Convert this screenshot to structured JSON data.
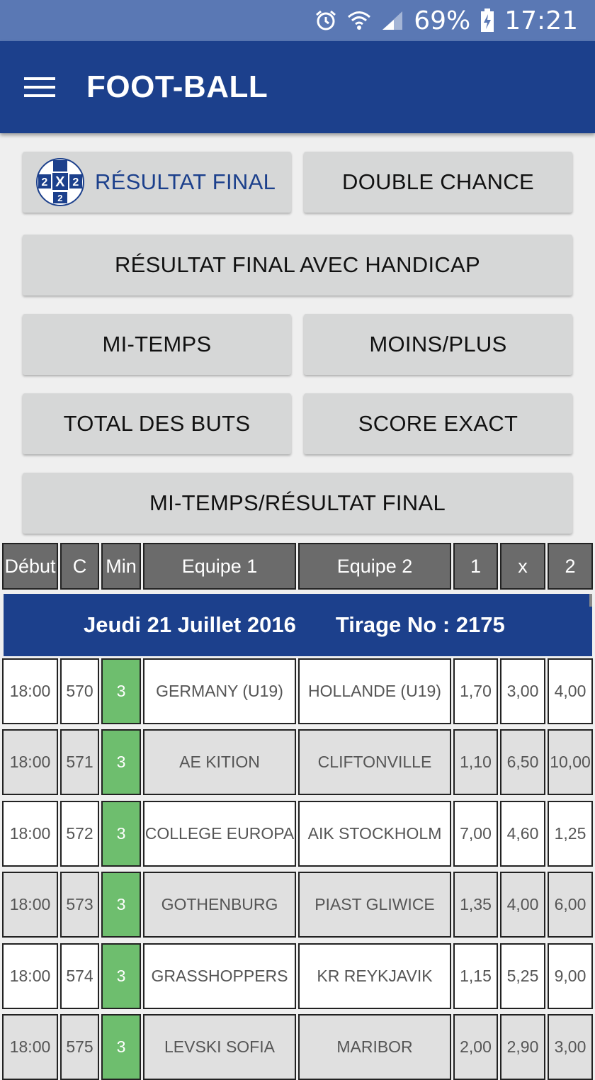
{
  "status_bar": {
    "battery": "69%",
    "time": "17:21",
    "icons": [
      "alarm-icon",
      "wifi-icon",
      "signal-icon",
      "battery-charging-icon"
    ]
  },
  "app_bar": {
    "title": "FOOT-BALL",
    "menu_icon": "hamburger-menu-icon"
  },
  "bet_types": {
    "resultat_final": "RÉSULTAT FINAL",
    "double_chance": "DOUBLE CHANCE",
    "handicap": "RÉSULTAT FINAL AVEC HANDICAP",
    "mi_temps": "MI-TEMPS",
    "moins_plus": "MOINS/PLUS",
    "total_buts": "TOTAL DES BUTS",
    "score_exact": "SCORE EXACT",
    "mi_temps_resultat": "MI-TEMPS/RÉSULTAT FINAL",
    "active_icon": "1x2-ball-icon",
    "active_color": "#1c408c"
  },
  "table": {
    "headers": [
      "Début",
      "C",
      "Min",
      "Equipe 1",
      "Equipe 2",
      "1",
      "x",
      "2"
    ],
    "date_label": "Jeudi 21 Juillet 2016",
    "draw_label": "Tirage No : 2175",
    "rows": [
      [
        "18:00",
        "570",
        "3",
        "GERMANY (U19)",
        "HOLLANDE (U19)",
        "1,70",
        "3,00",
        "4,00"
      ],
      [
        "18:00",
        "571",
        "3",
        "AE KITION",
        "CLIFTONVILLE",
        "1,10",
        "6,50",
        "10,00"
      ],
      [
        "18:00",
        "572",
        "3",
        "COLLEGE EUROPA",
        "AIK STOCKHOLM",
        "7,00",
        "4,60",
        "1,25"
      ],
      [
        "18:00",
        "573",
        "3",
        "GOTHENBURG",
        "PIAST GLIWICE",
        "1,35",
        "4,00",
        "6,00"
      ],
      [
        "18:00",
        "574",
        "3",
        "GRASSHOPPERS",
        "KR REYKJAVIK",
        "1,15",
        "5,25",
        "9,00"
      ],
      [
        "18:00",
        "575",
        "3",
        "LEVSKI SOFIA",
        "MARIBOR",
        "2,00",
        "2,90",
        "3,00"
      ]
    ],
    "colors": {
      "header_bg": "#6b6b6b",
      "banner_bg": "#1c408c",
      "min_bg": "#6ebe6e",
      "row_light": "#ffffff",
      "row_dark": "#e0e0e0"
    }
  }
}
